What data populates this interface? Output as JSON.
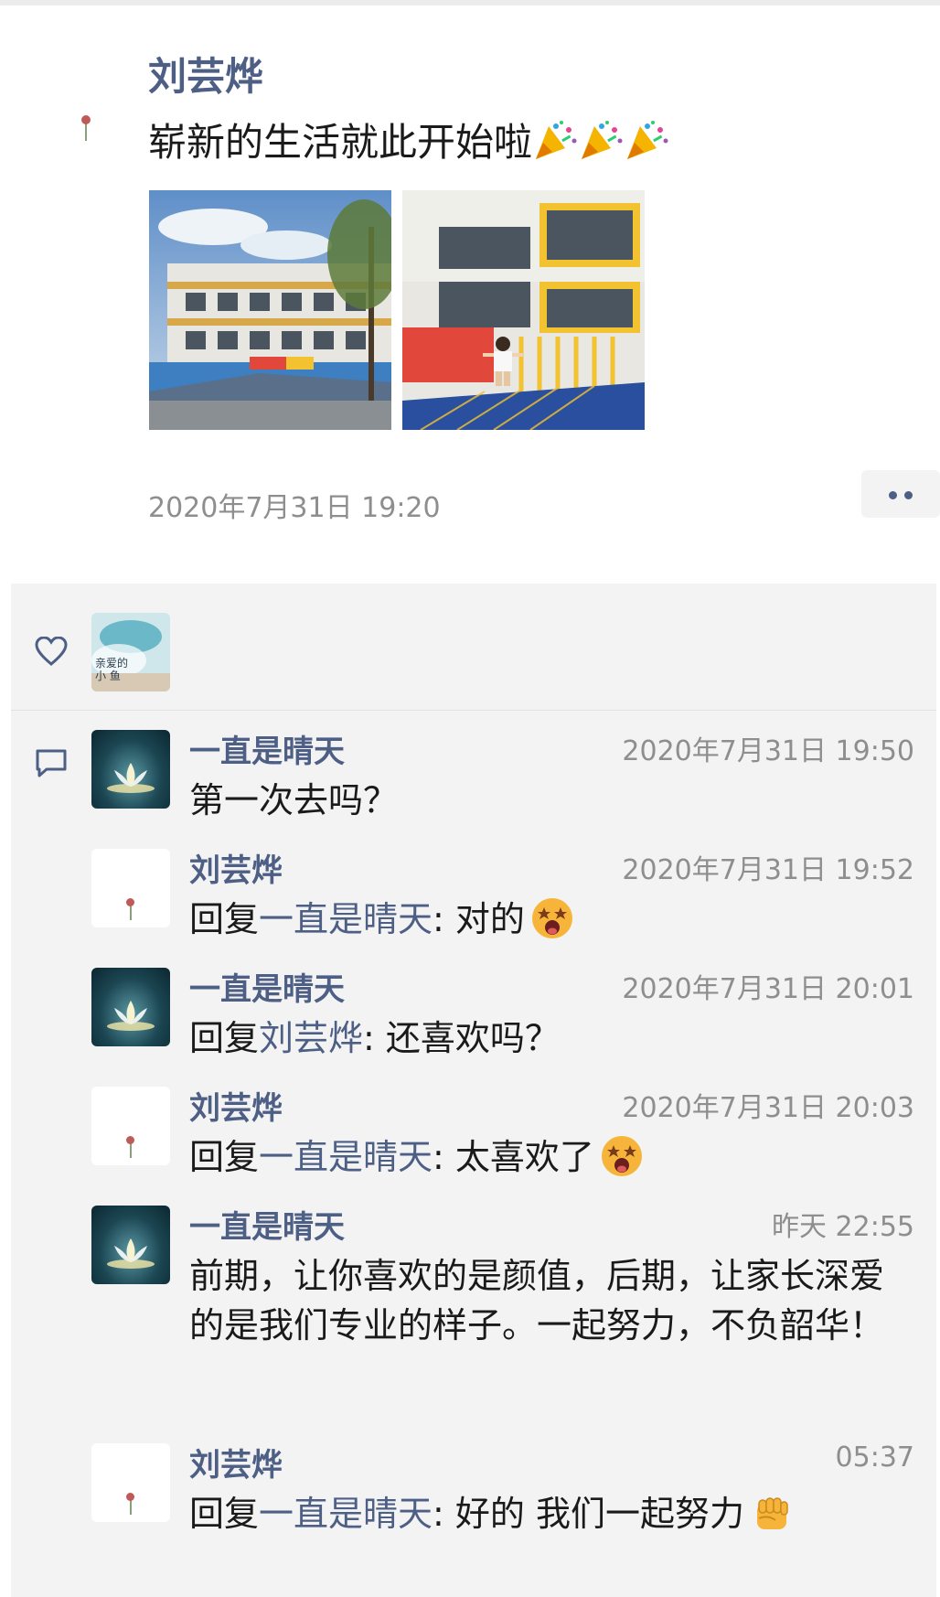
{
  "post": {
    "author": "刘芸烨",
    "text": "崭新的生活就此开始啦",
    "time": "2020年7月31日 19:20",
    "photos": [
      "kindergarten-building",
      "child-on-climbing-net"
    ]
  },
  "colors": {
    "name": "#4e5f86",
    "time": "#8e8e8e",
    "panel": "#f3f3f3",
    "text": "#1a1a1a"
  },
  "likes": {
    "icon": "heart-icon",
    "avatar_text": [
      "亲爱的",
      "小 鱼"
    ]
  },
  "comments": [
    {
      "name": "一直是晴天",
      "time": "2020年7月31日 19:50",
      "prefix": "",
      "target": "",
      "text": "第一次去吗？",
      "avatar": "sunny"
    },
    {
      "name": "刘芸烨",
      "time": "2020年7月31日 19:52",
      "prefix": "回复",
      "target": "一直是晴天",
      "text": ": 对的",
      "avatar": "rose",
      "emoji": "star-struck-emoji"
    },
    {
      "name": "一直是晴天",
      "time": "2020年7月31日 20:01",
      "prefix": "回复",
      "target": "刘芸烨",
      "text": ": 还喜欢吗？",
      "avatar": "sunny"
    },
    {
      "name": "刘芸烨",
      "time": "2020年7月31日 20:03",
      "prefix": "回复",
      "target": "一直是晴天",
      "text": ": 太喜欢了",
      "avatar": "rose",
      "emoji": "star-struck-emoji"
    },
    {
      "name": "一直是晴天",
      "time": "昨天 22:55",
      "prefix": "",
      "target": "",
      "text": "前期，让你喜欢的是颜值，后期，让家长深爱的是我们专业的样子。一起努力，不负韶华！",
      "avatar": "sunny"
    },
    {
      "name": "刘芸烨",
      "time": "05:37",
      "prefix": "回复",
      "target": "一直是晴天",
      "text": ": 好的 我们一起努力",
      "avatar": "rose",
      "emoji": "fist-emoji"
    }
  ]
}
